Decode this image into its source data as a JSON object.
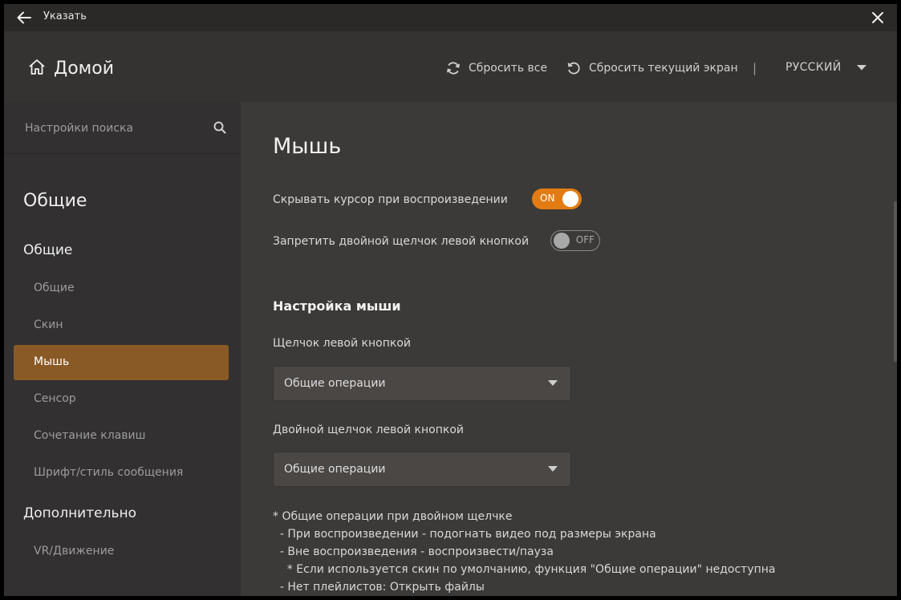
{
  "window": {
    "title": "Указать"
  },
  "header": {
    "home_label": "Домой",
    "reset_all": "Сбросить все",
    "reset_screen": "Сбросить текущий экран",
    "separator": "|",
    "language": "РУССКИЙ"
  },
  "sidebar": {
    "search_placeholder": "Настройки поиска",
    "heading": "Общие",
    "group1": "Общие",
    "items": [
      {
        "label": "Общие",
        "active": false
      },
      {
        "label": "Скин",
        "active": false
      },
      {
        "label": "Мышь",
        "active": true
      },
      {
        "label": "Сенсор",
        "active": false
      },
      {
        "label": "Сочетание клавиш",
        "active": false
      },
      {
        "label": "Шрифт/стиль сообщения",
        "active": false
      }
    ],
    "group2": "Дополнительно",
    "items2": [
      {
        "label": "VR/Движение"
      }
    ]
  },
  "main": {
    "title": "Мышь",
    "toggles": [
      {
        "label": "Скрывать курсор при воспроизведении",
        "state": "ON"
      },
      {
        "label": "Запретить двойной щелчок левой кнопкой",
        "state": "OFF"
      }
    ],
    "section_title": "Настройка мыши",
    "left_click_label": "Щелчок левой кнопкой",
    "left_click_value": "Общие операции",
    "double_click_label": "Двойной щелчок левой кнопкой",
    "double_click_value": "Общие операции",
    "notes": [
      "* Общие операции при двойном щелчке",
      "  - При воспроизведении - подогнать видео под размеры экрана",
      "  - Вне воспроизведения - воспроизвести/пауза",
      "    * Если используется скин по умолчанию, функция \"Общие операции\" недоступна",
      "  - Нет плейлистов: Открыть файлы"
    ]
  },
  "colors": {
    "accent": "#e27c12",
    "active_item": "#8a5a26"
  }
}
